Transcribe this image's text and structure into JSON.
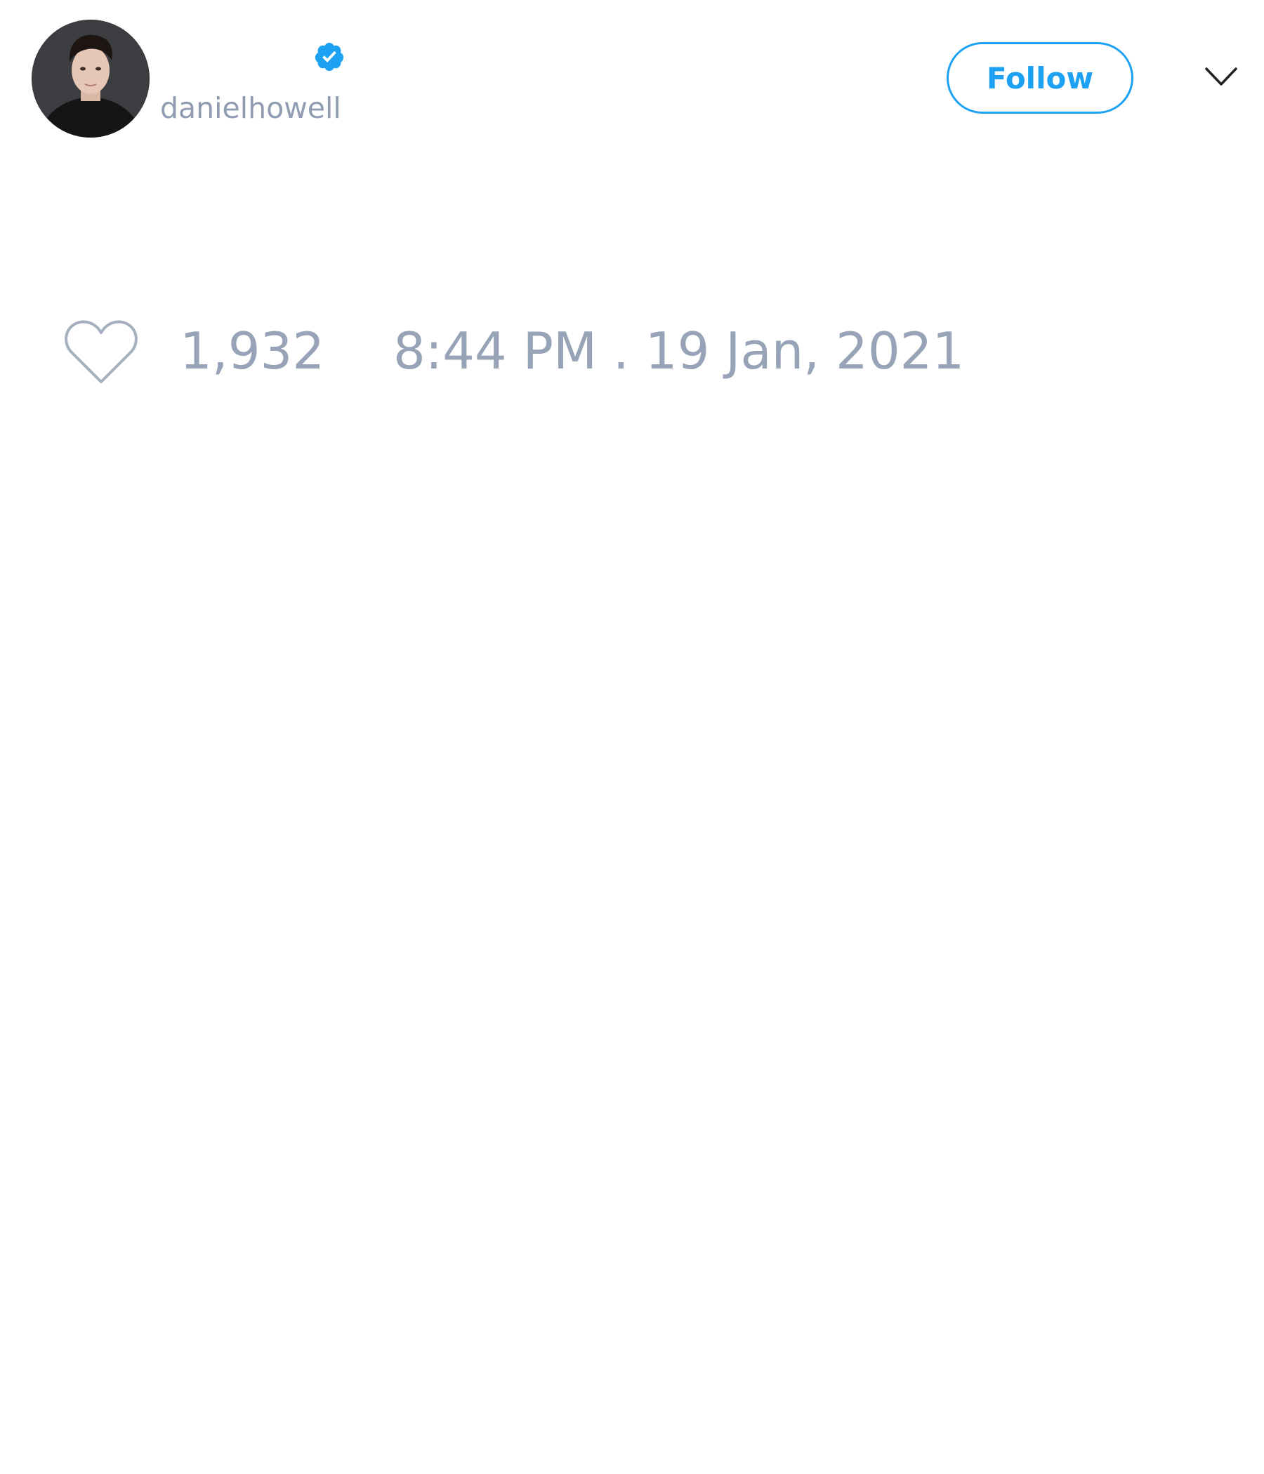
{
  "tweet": {
    "author": {
      "username": "danielhowell",
      "verified": true,
      "avatar_icon": "profile-photo",
      "verified_icon": "verified-badge-icon"
    },
    "follow_button_label": "Follow",
    "menu_icon": "chevron-down-icon",
    "likes": {
      "icon": "heart-outline-icon",
      "count": "1,932"
    },
    "timestamp": "8:44 PM . 19 Jan, 2021"
  },
  "colors": {
    "accent": "#1da1f2",
    "muted_text": "#8f9cb1",
    "background": "#ffffff"
  }
}
